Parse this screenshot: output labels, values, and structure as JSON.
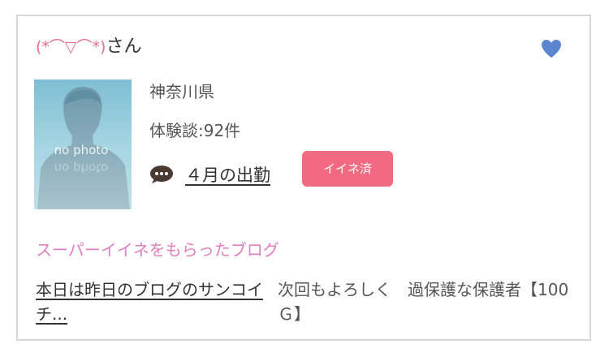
{
  "user": {
    "emoticon": "(*⌒▽⌒*)",
    "suffix": "さん"
  },
  "favorite_icon": "heart-icon",
  "photo": {
    "placeholder_text": "no photo",
    "reflection_text": "no photo"
  },
  "profile": {
    "region": "神奈川県",
    "reviews": "体験談:92件"
  },
  "attendance": {
    "icon": "speech-bubble-icon",
    "label": "４月の出勤"
  },
  "like_badge": {
    "label": "イイネ済",
    "color": "#f26a82"
  },
  "blog_section": {
    "title": "スーパーイイネをもらったブログ",
    "link_text": "本日は昨日のブログのサンコイチ...",
    "snippet": "次回もよろしく　過保護な保護者【100Ｇ】"
  },
  "colors": {
    "emoticon": "#e86b8a",
    "heart": "#5b86cf",
    "section_title": "#e07fbf",
    "border": "#d6d6d6"
  }
}
